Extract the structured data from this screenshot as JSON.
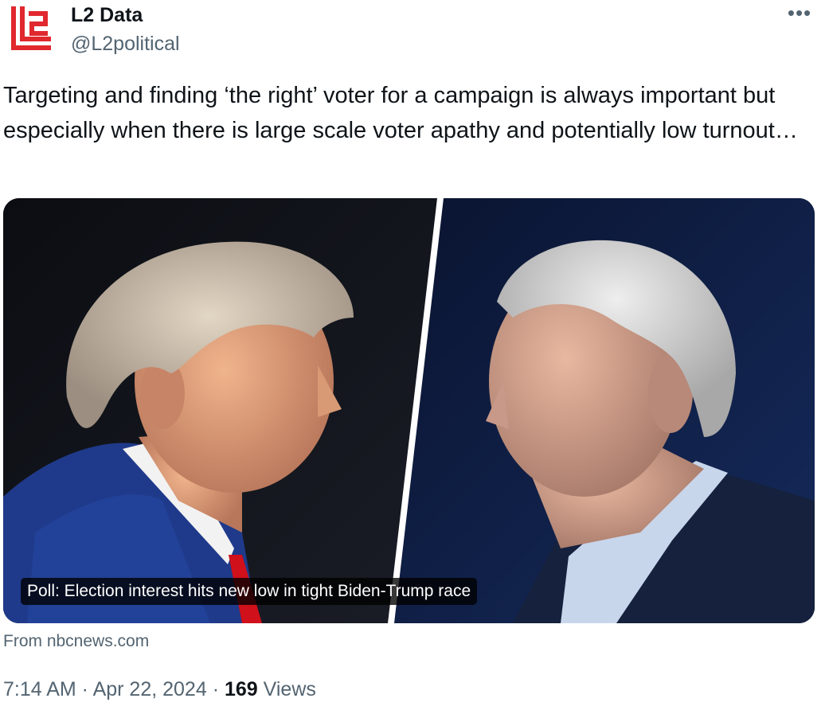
{
  "author": {
    "name": "L2 Data",
    "handle": "@L2political",
    "avatar_icon": "l2-logo-icon",
    "brand_color": "#e0282e"
  },
  "more_icon": "more-options-icon",
  "more_label": "•••",
  "tweet": {
    "text": "Targeting and finding ‘the right’ voter for a campaign is always important but especially when there is large scale voter apathy and potentially low turnout…"
  },
  "link_card": {
    "title": "Poll: Election interest hits new low in tight Biden-Trump race",
    "source": "From nbcnews.com"
  },
  "meta": {
    "time": "7:14 AM",
    "separator": " · ",
    "date": "Apr 22, 2024",
    "views_count": "169",
    "views_label": "Views"
  }
}
